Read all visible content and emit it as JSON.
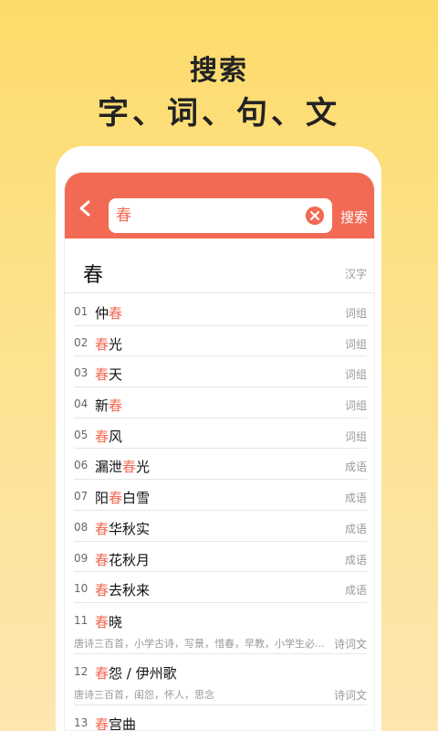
{
  "promo": {
    "line1": "搜索",
    "line2": "字、词、句、文"
  },
  "search": {
    "value": "春",
    "button_label": "搜索"
  },
  "hero": {
    "word": "春",
    "tag": "汉字"
  },
  "items": [
    {
      "num": "01",
      "pre": "仲",
      "hl": "春",
      "post": "",
      "tag": "词组"
    },
    {
      "num": "02",
      "pre": "",
      "hl": "春",
      "post": "光",
      "tag": "词组"
    },
    {
      "num": "03",
      "pre": "",
      "hl": "春",
      "post": "天",
      "tag": "词组"
    },
    {
      "num": "04",
      "pre": "新",
      "hl": "春",
      "post": "",
      "tag": "词组"
    },
    {
      "num": "05",
      "pre": "",
      "hl": "春",
      "post": "风",
      "tag": "词组"
    },
    {
      "num": "06",
      "pre": "漏泄",
      "hl": "春",
      "post": "光",
      "tag": "成语"
    },
    {
      "num": "07",
      "pre": "阳",
      "hl": "春",
      "post": "白雪",
      "tag": "成语"
    },
    {
      "num": "08",
      "pre": "",
      "hl": "春",
      "post": "华秋实",
      "tag": "成语"
    },
    {
      "num": "09",
      "pre": "",
      "hl": "春",
      "post": "花秋月",
      "tag": "成语"
    },
    {
      "num": "10",
      "pre": "",
      "hl": "春",
      "post": "去秋来",
      "tag": "成语"
    }
  ],
  "poems": [
    {
      "num": "11",
      "hl": "春",
      "post": "晓",
      "desc": "唐诗三百首，小学古诗，写景，惜春，早教，小学生必…",
      "tag": "诗词文"
    },
    {
      "num": "12",
      "hl": "春",
      "post": "怨 / 伊州歌",
      "desc": "唐诗三百首，闺怨，怀人，思念",
      "tag": "诗词文"
    },
    {
      "num": "13",
      "hl": "春",
      "post": "宫曲",
      "desc": "",
      "tag": ""
    }
  ]
}
